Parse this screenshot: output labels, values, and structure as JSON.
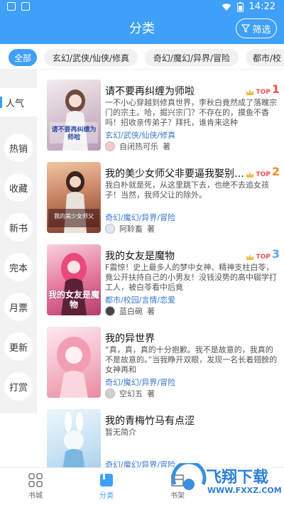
{
  "status": {
    "time": "14:22"
  },
  "header": {
    "title": "分类",
    "filter_label": "筛选"
  },
  "chips": [
    "全部",
    "玄幻/武侠/仙侠/修真",
    "奇幻/魔幻/异界/冒险",
    "都市/校"
  ],
  "sidebar": [
    "人气",
    "热销",
    "收藏",
    "新书",
    "完本",
    "月票",
    "更新",
    "打赏"
  ],
  "books": [
    {
      "title": "请不要再纠缠为师啦",
      "desc": "一不小心穿越到修真世界，李秋白竟然成了落魄宗门的宗主。哈，掘兴宗门？不存在的，摸鱼不香吗！招收亲传弟子？拜托，谁肯来这种",
      "tag": "玄幻/武侠/仙侠/修真",
      "author": "自闭热可乐",
      "author_suffix": "著",
      "rank_label": "TOP",
      "rank": "1",
      "cover_text": "请不要再纠缠为师啦",
      "rank_color": "#ef4f4f"
    },
    {
      "title": "我的美少女师父非要逼我娶别的…",
      "desc": "我白朴就是死，从这里跳下去，也绝不去追女孩子！当然，我师父让的除外。",
      "tag": "奇幻/魔幻/异界/冒险",
      "author": "阿聆畜",
      "author_suffix": "著",
      "rank_label": "TOP",
      "rank": "2",
      "cover_text": "我的美少女师父",
      "rank_color": "#f08a2c"
    },
    {
      "title": "我的女友是魔物",
      "desc": "F震惊！史上最多人的梦中女神、精神支柱白苓，竟公开扶持自己的小男友！没钱没势的高中辍学打工人，被白苓看中后竟",
      "tag": "都市/校园/言情/恋爱",
      "author": "蓝白碗",
      "author_suffix": "著",
      "rank_label": "TOP",
      "rank": "3",
      "cover_text": "我的女友是魔物",
      "rank_color": "#5aa9f0"
    },
    {
      "title": "我的异世界",
      "desc": "“真，真，真的十分抱歉。我不是故意的，我真的不是故意的。”当我睁开双眼，发现一名长着翅膀的女神再和",
      "tag": "奇幻/魔幻/异界/冒险",
      "author": "空幻五",
      "author_suffix": "著",
      "rank_label": "",
      "rank": "",
      "cover_text": "",
      "rank_color": "#5aa9f0"
    },
    {
      "title": "我的青梅竹马有点涩",
      "desc": "暂无简介",
      "tag": "奇幻/魔幻/异界/冒险",
      "author": "",
      "author_suffix": "",
      "rank_label": "",
      "rank": "",
      "cover_text": "",
      "rank_color": "#5aa9f0"
    }
  ],
  "bottom_nav": [
    "书城",
    "分类",
    "书架"
  ],
  "watermark": {
    "brand": "飞翔下载",
    "site": "WWW.FXXZ.COM"
  },
  "colors": {
    "accent": "#3ea0f7",
    "tag": "#3a78c8"
  }
}
